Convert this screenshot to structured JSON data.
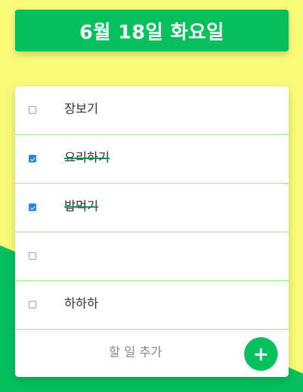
{
  "header": {
    "date_title": "6월 18일 화요일"
  },
  "todos": [
    {
      "text": "장보기",
      "checked": false
    },
    {
      "text": "요리하기",
      "checked": true
    },
    {
      "text": "밥먹기",
      "checked": true
    },
    {
      "text": "",
      "checked": false
    },
    {
      "text": "하하하",
      "checked": false
    }
  ],
  "add": {
    "placeholder": "할 일 추가",
    "button_icon": "plus-icon",
    "button_glyph": "+"
  },
  "colors": {
    "accent": "#06c05e",
    "background": "#fbfb7a",
    "check": "#2d7ff0",
    "divider": "#9be28f"
  }
}
